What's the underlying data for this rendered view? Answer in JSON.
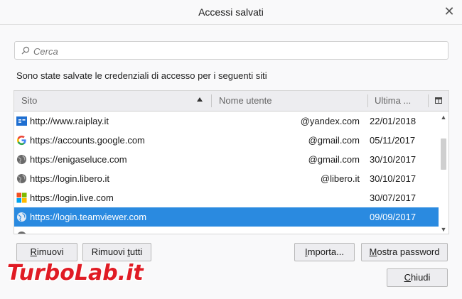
{
  "window": {
    "title": "Accessi salvati",
    "close_glyph": "✕"
  },
  "search": {
    "placeholder": "Cerca",
    "value": ""
  },
  "description": "Sono state salvate le credenziali di accesso per i seguenti siti",
  "table": {
    "columns": {
      "site": "Sito",
      "user": "Nome utente",
      "last": "Ultima ..."
    },
    "sorted_column": "Sito",
    "sort_direction": "ascending",
    "rows": [
      {
        "icon": "raiplay-favicon",
        "site": "http://www.raiplay.it",
        "user": "@yandex.com",
        "date": "22/01/2018",
        "selected": false
      },
      {
        "icon": "google-favicon",
        "site": "https://accounts.google.com",
        "user": "@gmail.com",
        "date": "05/11/2017",
        "selected": false
      },
      {
        "icon": "globe-icon",
        "site": "https://enigaseluce.com",
        "user": "@gmail.com",
        "date": "30/10/2017",
        "selected": false
      },
      {
        "icon": "globe-icon",
        "site": "https://login.libero.it",
        "user": "@libero.it",
        "date": "30/10/2017",
        "selected": false
      },
      {
        "icon": "microsoft-favicon",
        "site": "https://login.live.com",
        "user": "",
        "date": "30/07/2017",
        "selected": false
      },
      {
        "icon": "globe-icon",
        "site": "https://login.teamviewer.com",
        "user": "",
        "date": "09/09/2017",
        "selected": true
      }
    ]
  },
  "buttons": {
    "remove": {
      "prefix": "",
      "key": "R",
      "rest": "imuovi"
    },
    "remove_all": {
      "prefix": "Rimuovi ",
      "key": "t",
      "rest": "utti"
    },
    "import": {
      "prefix": "",
      "key": "I",
      "rest": "mporta..."
    },
    "show_passwords": {
      "prefix": "",
      "key": "M",
      "rest": "ostra password"
    },
    "close": {
      "prefix": "",
      "key": "C",
      "rest": "hiudi"
    }
  },
  "watermark": {
    "text": "TurboLab.it"
  },
  "colors": {
    "selection": "#2a8ae0",
    "header_bg": "#ededf0",
    "dialog_bg": "#f9f9fa"
  }
}
